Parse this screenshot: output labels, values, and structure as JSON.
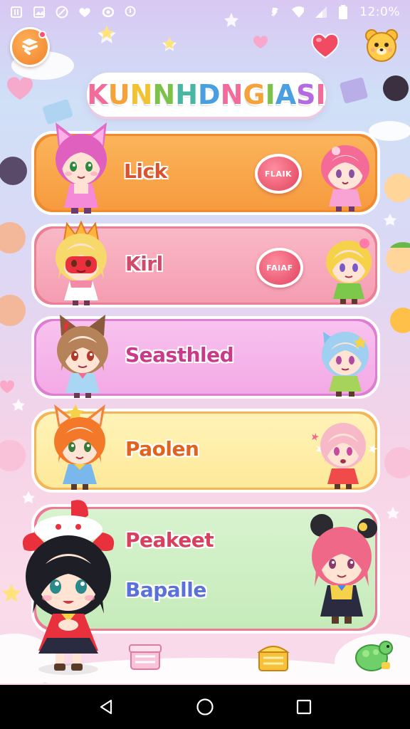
{
  "status_bar": {
    "time": "12:0%",
    "left_icons": [
      "notification-icon",
      "image-icon",
      "no-sim-icon",
      "heart-icon",
      "sync-icon",
      "location-icon"
    ],
    "right_icons": [
      "mute-icon",
      "wifi-icon",
      "signal-icon",
      "battery-icon"
    ]
  },
  "header": {
    "menu_icon": "menu-icon",
    "favorite_icon": "heart-icon",
    "profile_icon": "bear-icon"
  },
  "title": {
    "text": "KUNNHDNGIASI",
    "letters": [
      {
        "ch": "K",
        "color": "#f26b9a"
      },
      {
        "ch": "U",
        "color": "#f5a23a"
      },
      {
        "ch": "N",
        "color": "#f2c230"
      },
      {
        "ch": "N",
        "color": "#7cc24a"
      },
      {
        "ch": "H",
        "color": "#48b6a2"
      },
      {
        "ch": "D",
        "color": "#4a9fe0"
      },
      {
        "ch": "N",
        "color": "#f26b9a"
      },
      {
        "ch": "G",
        "color": "#f5a23a"
      },
      {
        "ch": "I",
        "color": "#7cc24a"
      },
      {
        "ch": "A",
        "color": "#4a9fe0"
      },
      {
        "ch": "S",
        "color": "#b46be0"
      },
      {
        "ch": "I",
        "color": "#f26b9a"
      }
    ]
  },
  "cards": [
    {
      "label": "Lick",
      "label_color": "#d9532f",
      "button_label": "FLAIK",
      "bg": "#fbb45a",
      "bg2": "#f79a3e",
      "border": "#f08a2e"
    },
    {
      "label": "Kirl",
      "label_color": "#d14a6a",
      "button_label": "FAIAF",
      "bg": "#f9b8c6",
      "bg2": "#f59db2",
      "border": "#ea7f96"
    },
    {
      "label": "Seasthled",
      "label_color": "#c93a8a",
      "bg": "#f8c2ee",
      "bg2": "#f3a9e6",
      "border": "#dc7fd0"
    },
    {
      "label": "Paolen",
      "label_color": "#e0641e",
      "bg": "#fff3b8",
      "bg2": "#fde999",
      "border": "#f3b55a"
    },
    {
      "label": "Peakeet",
      "label_color": "#d8405e",
      "sublabel": "Bapalle",
      "sublabel_color": "#5a72d8",
      "bg": "#d8f3cf",
      "bg2": "#c6ebba",
      "border": "#ec7a96"
    }
  ],
  "bottom_icons": [
    "gift-box-icon",
    "treasure-box-icon",
    "turtle-icon"
  ],
  "nav_bar": {
    "back_icon": "back-triangle-icon",
    "home_icon": "home-circle-icon",
    "recents_icon": "recents-square-icon"
  }
}
